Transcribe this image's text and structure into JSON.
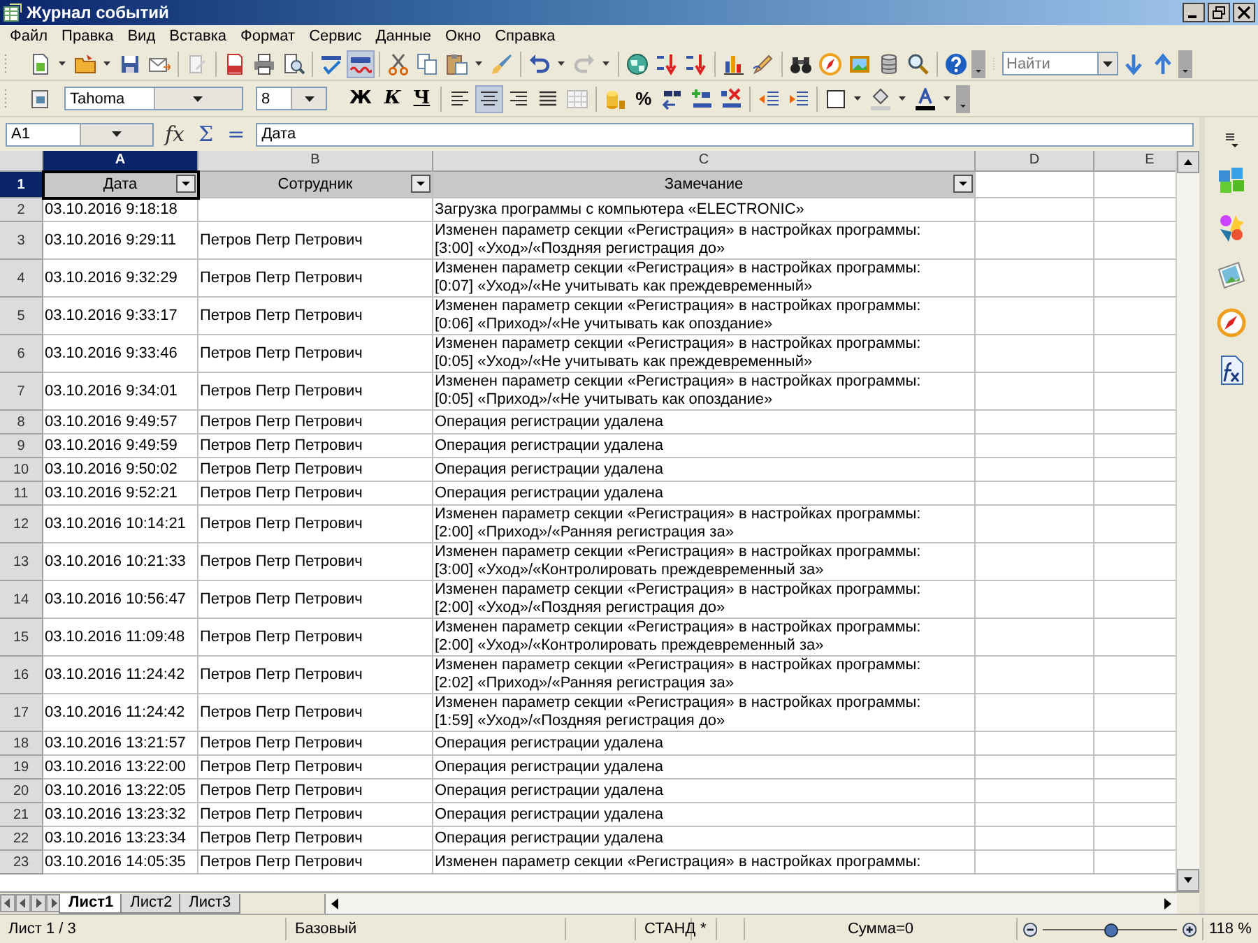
{
  "window": {
    "title": "Журнал событий"
  },
  "menu": [
    {
      "label": "Файл"
    },
    {
      "label": "Правка"
    },
    {
      "label": "Вид"
    },
    {
      "label": "Вставка"
    },
    {
      "label": "Формат"
    },
    {
      "label": "Сервис"
    },
    {
      "label": "Данные"
    },
    {
      "label": "Окно"
    },
    {
      "label": "Справка"
    }
  ],
  "standard_toolbar": {
    "autospellcheck": true,
    "find_placeholder": "Найти"
  },
  "formatting_toolbar": {
    "font": "Tahoma",
    "size": "8",
    "style_buttons": [
      "Ж",
      "К",
      "Ч"
    ],
    "alignment_buttons": [
      {
        "selected": false
      },
      {
        "selected": true
      },
      {
        "selected": false
      },
      {
        "selected": false
      }
    ],
    "percent": "%"
  },
  "formula_bar": {
    "cell_reference": "A1",
    "buttons": [
      "fx",
      "Σ",
      "="
    ],
    "content": "Дата"
  },
  "sheet": {
    "columns": [
      {
        "label": "A",
        "selected": true
      },
      {
        "label": "B",
        "selected": false
      },
      {
        "label": "C",
        "selected": false
      },
      {
        "label": "D",
        "selected": false
      },
      {
        "label": "E",
        "selected": false
      }
    ],
    "rows": [
      {
        "number": "1",
        "kind": "filter_header",
        "selected": true,
        "cells": [
          "Дата",
          "Сотрудник",
          "Замечание"
        ]
      },
      {
        "number": "2",
        "kind": "data",
        "selected": false,
        "cells": [
          "03.10.2016 9:18:18",
          "",
          "Загрузка программы с компьютера «ELECTRONIC»"
        ]
      },
      {
        "number": "3",
        "kind": "data",
        "selected": false,
        "cells": [
          "03.10.2016 9:29:11",
          "Петров Петр Петрович",
          "Изменен параметр секции «Регистрация» в настройках программы:\n[3:00] «Уход»/«Поздняя регистрация до»"
        ]
      },
      {
        "number": "4",
        "kind": "data",
        "selected": false,
        "cells": [
          "03.10.2016 9:32:29",
          "Петров Петр Петрович",
          "Изменен параметр секции «Регистрация» в настройках программы:\n[0:07] «Уход»/«Не учитывать как преждевременный»"
        ]
      },
      {
        "number": "5",
        "kind": "data",
        "selected": false,
        "cells": [
          "03.10.2016 9:33:17",
          "Петров Петр Петрович",
          "Изменен параметр секции «Регистрация» в настройках программы:\n[0:06] «Приход»/«Не учитывать как опоздание»"
        ]
      },
      {
        "number": "6",
        "kind": "data",
        "selected": false,
        "cells": [
          "03.10.2016 9:33:46",
          "Петров Петр Петрович",
          "Изменен параметр секции «Регистрация» в настройках программы:\n[0:05] «Уход»/«Не учитывать как преждевременный»"
        ]
      },
      {
        "number": "7",
        "kind": "data",
        "selected": false,
        "cells": [
          "03.10.2016 9:34:01",
          "Петров Петр Петрович",
          "Изменен параметр секции «Регистрация» в настройках программы:\n[0:05] «Приход»/«Не учитывать как опоздание»"
        ]
      },
      {
        "number": "8",
        "kind": "data",
        "selected": false,
        "cells": [
          "03.10.2016 9:49:57",
          "Петров Петр Петрович",
          "Операция регистрации удалена"
        ]
      },
      {
        "number": "9",
        "kind": "data",
        "selected": false,
        "cells": [
          "03.10.2016 9:49:59",
          "Петров Петр Петрович",
          "Операция регистрации удалена"
        ]
      },
      {
        "number": "10",
        "kind": "data",
        "selected": false,
        "cells": [
          "03.10.2016 9:50:02",
          "Петров Петр Петрович",
          "Операция регистрации удалена"
        ]
      },
      {
        "number": "11",
        "kind": "data",
        "selected": false,
        "cells": [
          "03.10.2016 9:52:21",
          "Петров Петр Петрович",
          "Операция регистрации удалена"
        ]
      },
      {
        "number": "12",
        "kind": "data",
        "selected": false,
        "cells": [
          "03.10.2016 10:14:21",
          "Петров Петр Петрович",
          "Изменен параметр секции «Регистрация» в настройках программы:\n[2:00] «Приход»/«Ранняя регистрация за»"
        ]
      },
      {
        "number": "13",
        "kind": "data",
        "selected": false,
        "cells": [
          "03.10.2016 10:21:33",
          "Петров Петр Петрович",
          "Изменен параметр секции «Регистрация» в настройках программы:\n[3:00] «Уход»/«Контролировать преждевременный за»"
        ]
      },
      {
        "number": "14",
        "kind": "data",
        "selected": false,
        "cells": [
          "03.10.2016 10:56:47",
          "Петров Петр Петрович",
          "Изменен параметр секции «Регистрация» в настройках программы:\n[2:00] «Уход»/«Поздняя регистрация до»"
        ]
      },
      {
        "number": "15",
        "kind": "data",
        "selected": false,
        "cells": [
          "03.10.2016 11:09:48",
          "Петров Петр Петрович",
          "Изменен параметр секции «Регистрация» в настройках программы:\n[2:00] «Уход»/«Контролировать преждевременный за»"
        ]
      },
      {
        "number": "16",
        "kind": "data",
        "selected": false,
        "cells": [
          "03.10.2016 11:24:42",
          "Петров Петр Петрович",
          "Изменен параметр секции «Регистрация» в настройках программы:\n[2:02] «Приход»/«Ранняя регистрация за»"
        ]
      },
      {
        "number": "17",
        "kind": "data",
        "selected": false,
        "cells": [
          "03.10.2016 11:24:42",
          "Петров Петр Петрович",
          "Изменен параметр секции «Регистрация» в настройках программы:\n[1:59] «Уход»/«Поздняя регистрация до»"
        ]
      },
      {
        "number": "18",
        "kind": "data",
        "selected": false,
        "cells": [
          "03.10.2016 13:21:57",
          "Петров Петр Петрович",
          "Операция регистрации удалена"
        ]
      },
      {
        "number": "19",
        "kind": "data",
        "selected": false,
        "cells": [
          "03.10.2016 13:22:00",
          "Петров Петр Петрович",
          "Операция регистрации удалена"
        ]
      },
      {
        "number": "20",
        "kind": "data",
        "selected": false,
        "cells": [
          "03.10.2016 13:22:05",
          "Петров Петр Петрович",
          "Операция регистрации удалена"
        ]
      },
      {
        "number": "21",
        "kind": "data",
        "selected": false,
        "cells": [
          "03.10.2016 13:23:32",
          "Петров Петр Петрович",
          "Операция регистрации удалена"
        ]
      },
      {
        "number": "22",
        "kind": "data",
        "selected": false,
        "cells": [
          "03.10.2016 13:23:34",
          "Петров Петр Петрович",
          "Операция регистрации удалена"
        ]
      },
      {
        "number": "23",
        "kind": "data",
        "selected": false,
        "cells": [
          "03.10.2016 14:05:35",
          "Петров Петр Петрович",
          "Изменен параметр секции «Регистрация» в настройках программы:"
        ]
      }
    ]
  },
  "sheet_tabs": [
    {
      "label": "Лист1",
      "selected": true
    },
    {
      "label": "Лист2",
      "selected": false
    },
    {
      "label": "Лист3",
      "selected": false
    }
  ],
  "status_bar": {
    "sheet": "Лист 1 / 3",
    "page_style": "Базовый",
    "mode": "СТАНД",
    "modified": "*",
    "sum": "Сумма=0",
    "zoom": {
      "level": 0.5
    },
    "zoom_reading": "118 %"
  }
}
